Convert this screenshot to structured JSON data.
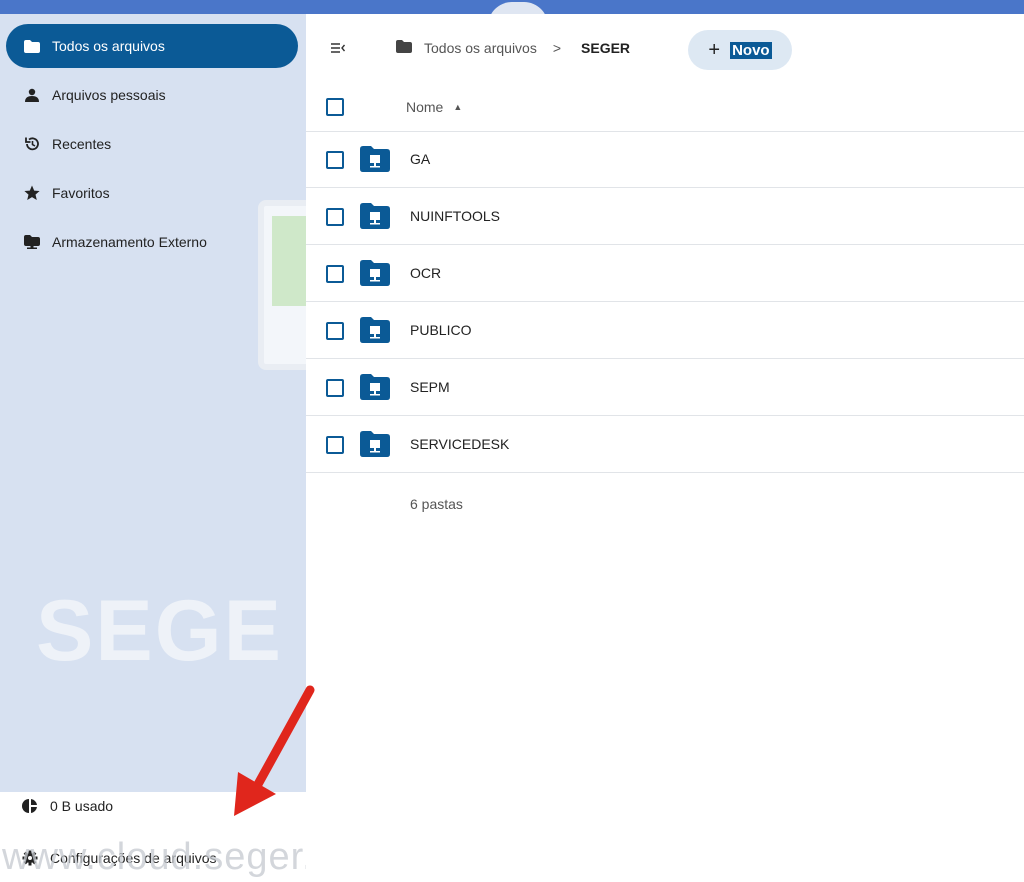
{
  "sidebar": {
    "items": [
      {
        "label": "Todos os arquivos",
        "icon": "folder-icon",
        "active": true
      },
      {
        "label": "Arquivos pessoais",
        "icon": "user-icon"
      },
      {
        "label": "Recentes",
        "icon": "history-icon"
      },
      {
        "label": "Favoritos",
        "icon": "star-icon"
      },
      {
        "label": "Armazenamento Externo",
        "icon": "external-storage-icon"
      }
    ],
    "background_text": "SEGE",
    "footer": {
      "quota_label": "0 B usado",
      "settings_label": "Configurações de arquivos"
    }
  },
  "watermark": "www.cloud.seger.es.g",
  "breadcrumb": {
    "root": "Todos os arquivos",
    "separator": ">",
    "current": "SEGER"
  },
  "toolbar": {
    "new_plus": "+",
    "new_label": "Novo"
  },
  "file_list": {
    "column_name": "Nome",
    "rows": [
      "GA",
      "NUINFTOOLS",
      "OCR",
      "PUBLICO",
      "SEPM",
      "SERVICEDESK"
    ],
    "summary": "6 pastas"
  },
  "colors": {
    "accent": "#0b5a96",
    "sidebar_bg": "#d7e1f1",
    "topbar": "#4a76c9",
    "annotation_arrow": "#e0261c"
  }
}
